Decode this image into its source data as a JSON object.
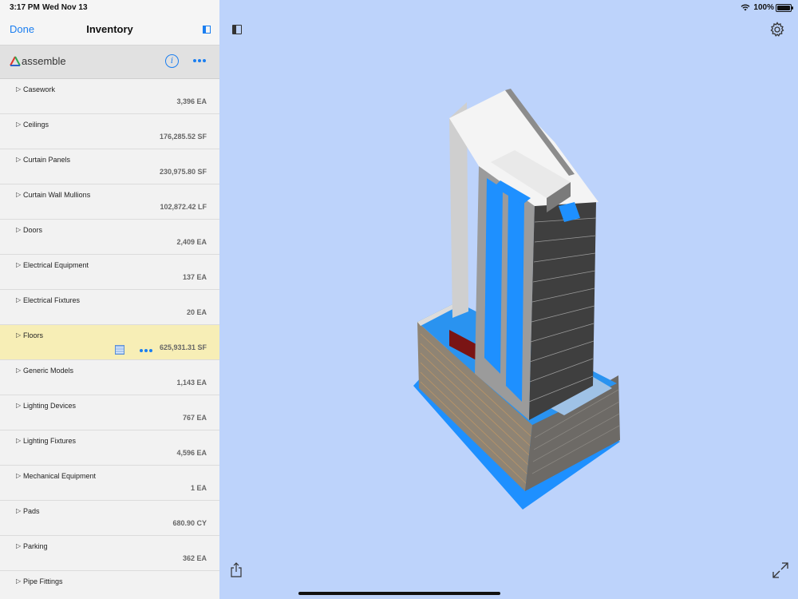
{
  "status_bar": {
    "time": "3:17 PM",
    "date": "Wed Nov 13",
    "battery": "100%"
  },
  "navbar": {
    "done_label": "Done",
    "title": "Inventory"
  },
  "brand": {
    "name": "assemble"
  },
  "inventory": [
    {
      "name": "Casework",
      "quantity": "3,396 EA"
    },
    {
      "name": "Ceilings",
      "quantity": "176,285.52 SF"
    },
    {
      "name": "Curtain Panels",
      "quantity": "230,975.80 SF"
    },
    {
      "name": "Curtain Wall Mullions",
      "quantity": "102,872.42 LF"
    },
    {
      "name": "Doors",
      "quantity": "2,409 EA"
    },
    {
      "name": "Electrical Equipment",
      "quantity": "137 EA"
    },
    {
      "name": "Electrical Fixtures",
      "quantity": "20 EA"
    },
    {
      "name": "Floors",
      "quantity": "625,931.31 SF",
      "selected": true
    },
    {
      "name": "Generic Models",
      "quantity": "1,143 EA"
    },
    {
      "name": "Lighting Devices",
      "quantity": "767 EA"
    },
    {
      "name": "Lighting Fixtures",
      "quantity": "4,596 EA"
    },
    {
      "name": "Mechanical Equipment",
      "quantity": "1 EA"
    },
    {
      "name": "Pads",
      "quantity": "680.90 CY"
    },
    {
      "name": "Parking",
      "quantity": "362 EA"
    },
    {
      "name": "Pipe Fittings",
      "quantity": ""
    }
  ],
  "colors": {
    "accent": "#1a7ef0",
    "selected_row": "#f7eeb6",
    "viewer_bg": "#bdd3fb",
    "floor_highlight": "#1e90ff"
  },
  "icons": [
    "sidebar-toggle-icon",
    "gear-icon",
    "share-icon",
    "expand-icon",
    "info-icon",
    "more-icon",
    "table-icon",
    "wifi-icon",
    "battery-icon"
  ]
}
